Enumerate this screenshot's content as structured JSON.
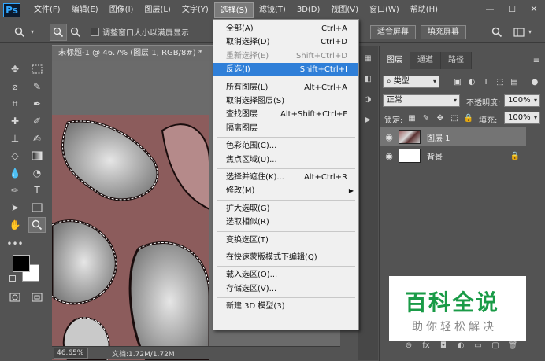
{
  "app": {
    "logo": "Ps"
  },
  "menubar": {
    "items": [
      "文件(F)",
      "编辑(E)",
      "图像(I)",
      "图层(L)",
      "文字(Y)",
      "选择(S)",
      "滤镜(T)",
      "3D(D)",
      "视图(V)",
      "窗口(W)",
      "帮助(H)"
    ],
    "active_index": 5,
    "window_controls": [
      "—",
      "☐",
      "✕"
    ]
  },
  "options": {
    "resize_windows_label": "调整窗口大小以满屏显示",
    "fit_screen_label": "适合屏幕",
    "fill_screen_label": "填充屏幕"
  },
  "document": {
    "tab_title": "未标题-1 @ 46.7% (图层 1, RGB/8#) *",
    "zoom": "46.65%",
    "doc_info": "文档:1.72M/1.72M"
  },
  "select_menu": [
    {
      "label": "全部(A)",
      "shortcut": "Ctrl+A"
    },
    {
      "label": "取消选择(D)",
      "shortcut": "Ctrl+D"
    },
    {
      "label": "重新选择(E)",
      "shortcut": "Shift+Ctrl+D",
      "disabled": true
    },
    {
      "label": "反选(I)",
      "shortcut": "Shift+Ctrl+I",
      "highlight": true
    },
    {
      "sep": true
    },
    {
      "label": "所有图层(L)",
      "shortcut": "Alt+Ctrl+A"
    },
    {
      "label": "取消选择图层(S)",
      "shortcut": ""
    },
    {
      "label": "查找图层",
      "shortcut": "Alt+Shift+Ctrl+F"
    },
    {
      "label": "隔离图层",
      "shortcut": ""
    },
    {
      "sep": true
    },
    {
      "label": "色彩范围(C)...",
      "shortcut": ""
    },
    {
      "label": "焦点区域(U)...",
      "shortcut": ""
    },
    {
      "sep": true
    },
    {
      "label": "选择并遮住(K)...",
      "shortcut": "Alt+Ctrl+R"
    },
    {
      "label": "修改(M)",
      "shortcut": "",
      "submenu": true
    },
    {
      "sep": true
    },
    {
      "label": "扩大选取(G)",
      "shortcut": ""
    },
    {
      "label": "选取相似(R)",
      "shortcut": ""
    },
    {
      "sep": true
    },
    {
      "label": "变换选区(T)",
      "shortcut": ""
    },
    {
      "sep": true
    },
    {
      "label": "在快速蒙版模式下编辑(Q)",
      "shortcut": ""
    },
    {
      "sep": true
    },
    {
      "label": "载入选区(O)...",
      "shortcut": ""
    },
    {
      "label": "存储选区(V)...",
      "shortcut": ""
    },
    {
      "sep": true
    },
    {
      "label": "新建 3D 模型(3)",
      "shortcut": ""
    }
  ],
  "layers_panel": {
    "tabs": [
      "图层",
      "通道",
      "路径"
    ],
    "active_tab": 0,
    "filter_kind": "类型",
    "blend_mode": "正常",
    "opacity_label": "不透明度:",
    "opacity_value": "100%",
    "lock_label": "锁定:",
    "fill_label": "填充:",
    "fill_value": "100%",
    "layers": [
      {
        "name": "图层 1",
        "selected": true,
        "thumb": "marble"
      },
      {
        "name": "背景",
        "selected": false,
        "thumb": "white",
        "locked": true
      }
    ],
    "footer_icons": [
      "link-icon",
      "fx-icon",
      "mask-icon",
      "adjustment-icon",
      "group-icon",
      "new-layer-icon",
      "trash-icon"
    ],
    "footer_glyphs": [
      "⊝",
      "fx",
      "◘",
      "◐",
      "▭",
      "▢",
      "🗑"
    ]
  },
  "watermark": {
    "main": "百科全说",
    "sub": "助你轻松解决"
  },
  "colors": {
    "accent": "#2f7fd8",
    "watermark_green": "#1a9b47"
  }
}
